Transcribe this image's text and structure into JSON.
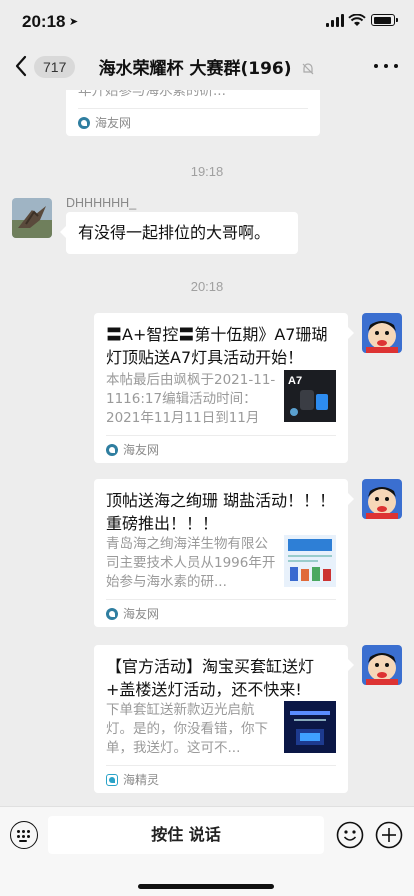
{
  "status_bar": {
    "time": "20:18",
    "battery_level": 0.8
  },
  "nav": {
    "unread_count": "717",
    "title": "海水荣耀杯 大赛群(196)"
  },
  "messages": {
    "top_card": {
      "desc_tail": "年开始参与海水素的研...",
      "source": "海友网"
    },
    "timestamp_1": "19:18",
    "text_msg": {
      "sender": "DHHHHHH_",
      "text": "有没得一起排位的大哥啊。"
    },
    "timestamp_2": "20:18",
    "cards": [
      {
        "title": "〓A+智控〓第十伍期》A7珊瑚灯顶贴送A7灯具活动开始！",
        "desc": "本帖最后由飒枫于2021-11-1116:17编辑活动时间：2021年11月11日到11月2...",
        "thumb_label": "A7",
        "source": "海友网"
      },
      {
        "title": "顶帖送海之绚珊 瑚盐活动！！！ 重磅推出！！！",
        "desc": "青岛海之绚海洋生物有限公司主要技术人员从1996年开始参与海水素的研...",
        "source": "海友网"
      },
      {
        "title": "【官方活动】淘宝买套缸送灯+盖楼送灯活动，还不快来!",
        "desc": "下单套缸送新款迈光启航灯。是的，你没看错，你下单，我送灯。这可不...",
        "source": "海精灵"
      }
    ]
  },
  "input_bar": {
    "hold_to_talk": "按住 说话"
  },
  "icons": {
    "back": "chevron-left-icon",
    "mute": "mute-bell-icon",
    "more": "more-dots-icon",
    "voice": "keyboard-icon",
    "emoji": "emoji-icon",
    "plus": "plus-icon"
  },
  "colors": {
    "background": "#ededed",
    "card": "#ffffff",
    "accent_source": "#2f7ea0"
  }
}
